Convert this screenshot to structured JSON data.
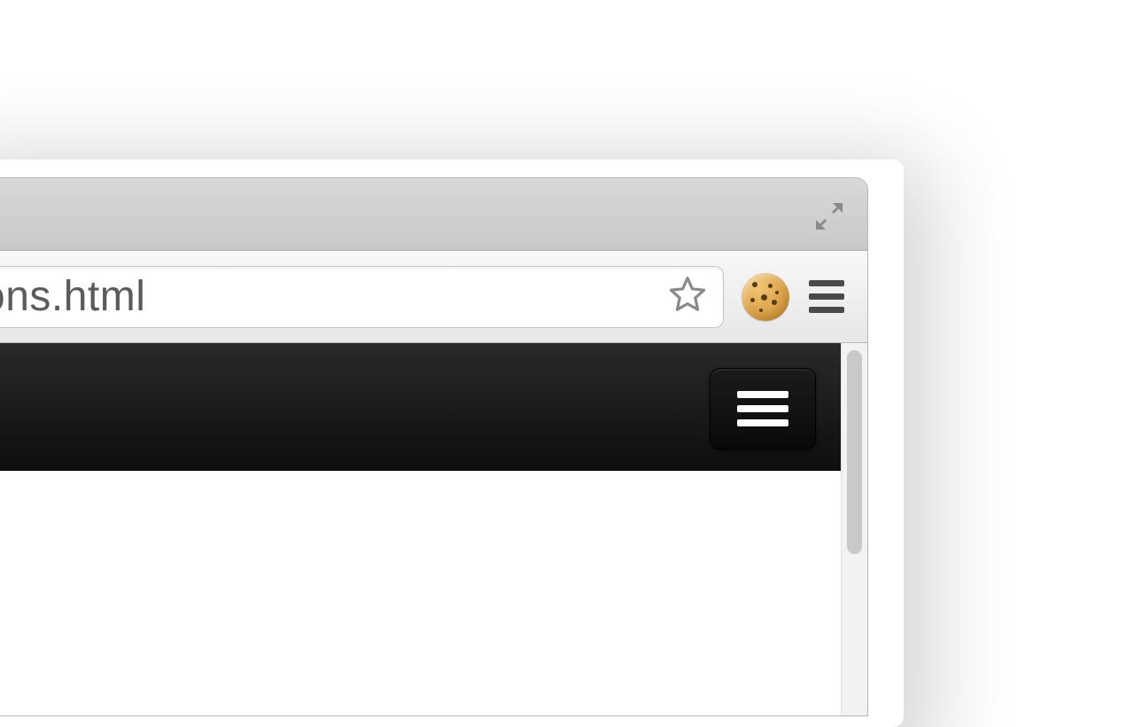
{
  "address_bar": {
    "visible_text": "tions.html"
  },
  "toolbar": {
    "bookmark_tooltip": "Bookmark this page",
    "extension_tooltip": "Cookie extension",
    "menu_tooltip": "Customize and control"
  },
  "titlebar": {
    "fullscreen_tooltip": "Enter Full Screen"
  },
  "page": {
    "nav_menu_tooltip": "Toggle navigation"
  }
}
